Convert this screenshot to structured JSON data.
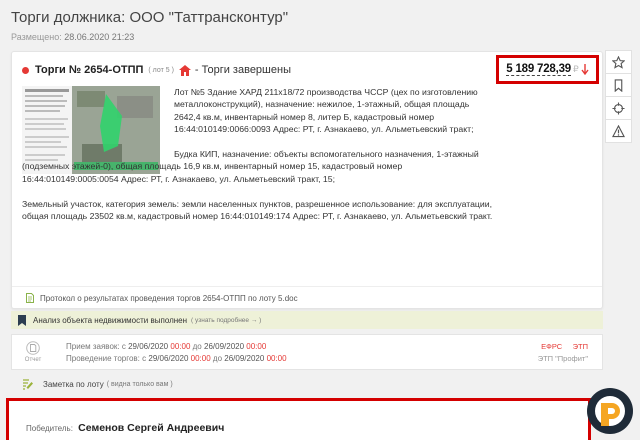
{
  "page": {
    "title": "Торги должника: ООО \"Таттрансконтур\"",
    "posted_label": "Размещено:",
    "posted_value": "28.06.2020 21:23"
  },
  "lot": {
    "number": "Торги № 2654-ОТПП",
    "lot_label": "( лот 5 )",
    "status": "- Торги завершены",
    "price": "5 189 728,39",
    "currency": "₽",
    "description": [
      "Лот №5 Здание ХАРД 211х18/72 производства ЧССР (цех по изготовлению металлоконструкций), назначение: нежилое, 1-этажный, общая площадь 2642,4 кв.м, инвентарный номер 8, литер Б, кадастровый номер 16:44:010149:0066:0093 Адрес: РТ, г. Азнакаево, ул. Альметьевский тракт;",
      "Будка КИП, назначение: объекты вспомогательного назначения, 1-этажный (подземных этажей-0), общая площадь 16,9 кв.м, инвентарный номер 15, кадастровый номер 16:44:010149:0005:0054 Адрес: РТ, г. Азнакаево, ул. Альметьевский тракт, 15;",
      "Земельный участок, категория земель: земли населенных пунктов, разрешенное использование: для эксплуатации, общая площадь 23502 кв.м, кадастровый номер 16:44:010149:174 Адрес: РТ, г. Азнакаево, ул. Альметьевский тракт."
    ],
    "protocol": "Протокол о результатах проведения торгов 2654-ОТПП по лоту 5.doc"
  },
  "side_buttons": [
    "star-icon",
    "bookmark-icon",
    "target-icon",
    "warning-icon"
  ],
  "analysis": {
    "text": "Анализ объекта недвижимости выполнен",
    "more": "( узнать подробнее → )"
  },
  "dates": {
    "report_label": "Отчет",
    "apps_label": "Прием заявок:",
    "auction_label": "Проведение торгов:",
    "from": "с",
    "to": "до",
    "apps_start": "29/06/2020",
    "apps_start_time": "00:00",
    "apps_end": "26/09/2020",
    "apps_end_time": "00:00",
    "auction_start": "29/06/2020",
    "auction_start_time": "00:00",
    "auction_end": "26/09/2020",
    "auction_end_time": "00:00",
    "source_1": "ЕФРС",
    "source_2": "ЭТП",
    "platform": "ЭТП \"Профит\""
  },
  "note": {
    "label": "Заметка по лоту",
    "visibility": "( видна только вам )"
  },
  "winner": {
    "label": "Победитель:",
    "name": "Семенов Сергей Андреевич"
  },
  "colors": {
    "accent_red": "#d40000",
    "status_dot": "#e53935",
    "badge_orange": "#f5a623",
    "badge_dark": "#1f2b38"
  }
}
